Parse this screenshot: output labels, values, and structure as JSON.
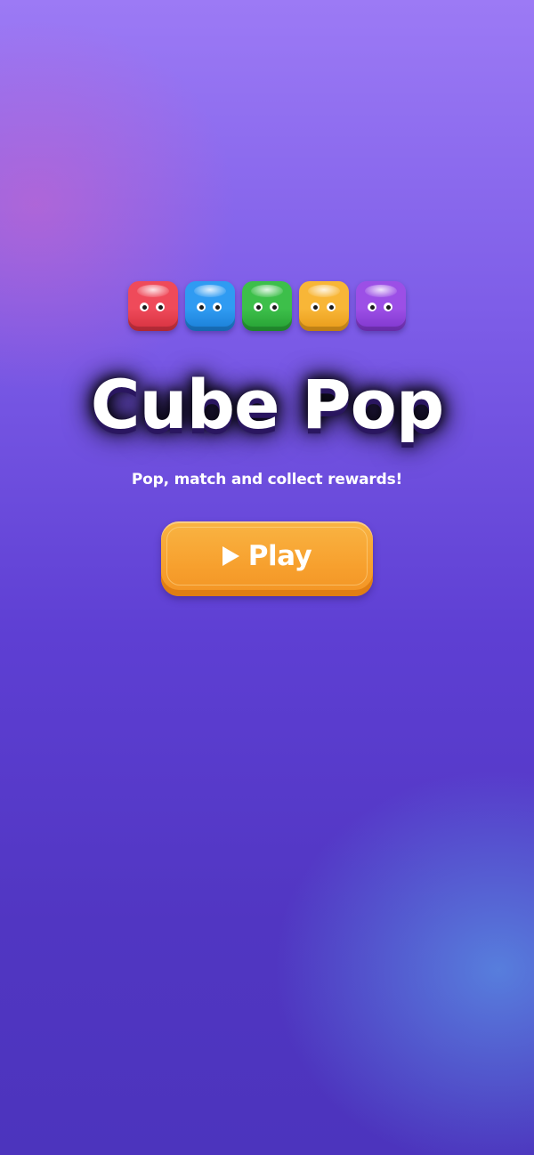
{
  "colors": {
    "background_top": "#9c7af5",
    "background_bottom": "#4c34bd",
    "button": "#f7a02e",
    "text": "#ffffff"
  },
  "cubes": [
    {
      "color": "#ef4a5a",
      "shade": "#d6303f"
    },
    {
      "color": "#2f9bf2",
      "shade": "#1a7ed6"
    },
    {
      "color": "#3dbf4a",
      "shade": "#25a033"
    },
    {
      "color": "#f8b637",
      "shade": "#e89a18"
    },
    {
      "color": "#9c4fe6",
      "shade": "#7f35cc"
    }
  ],
  "title": "Cube Pop",
  "subtitle": "Pop, match and collect rewards!",
  "play_button": {
    "icon": "play-icon",
    "label": "Play"
  }
}
